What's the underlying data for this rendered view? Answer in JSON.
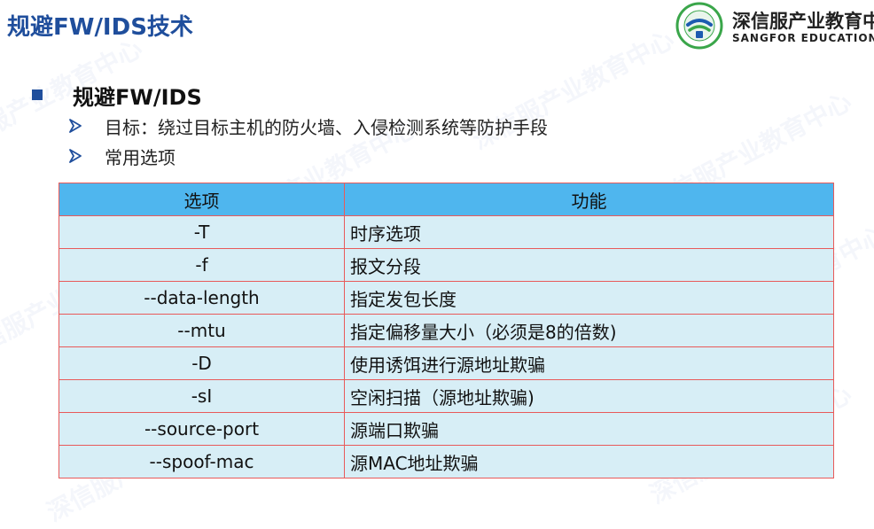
{
  "slide_title": "规避FW/IDS技术",
  "logo": {
    "cn_name": "深信服产业教育中",
    "en_name": "SANGFOR EDUCATION CEN",
    "colors": {
      "green": "#3aa64a",
      "blue": "#1c5bb0"
    }
  },
  "watermark": {
    "cn": "深信服产业教育中心",
    "en": "SANGFOR EDUCATION CENTER"
  },
  "section": {
    "heading": "规避FW/IDS",
    "bullets": [
      "目标：绕过目标主机的防火墙、入侵检测系统等防护手段",
      "常用选项"
    ]
  },
  "table": {
    "headers": [
      "选项",
      "功能"
    ],
    "rows": [
      {
        "option": "-T",
        "function": "时序选项"
      },
      {
        "option": "-f",
        "function": "报文分段"
      },
      {
        "option": "--data-length",
        "function": "指定发包长度"
      },
      {
        "option": "--mtu",
        "function": "指定偏移量大小（必须是8的倍数)"
      },
      {
        "option": "-D",
        "function": "使用诱饵进行源地址欺骗"
      },
      {
        "option": "-sI",
        "function": "空闲扫描（源地址欺骗)"
      },
      {
        "option": "--source-port",
        "function": "源端口欺骗"
      },
      {
        "option": "--spoof-mac",
        "function": "源MAC地址欺骗"
      }
    ],
    "colors": {
      "header_bg": "#4fb6ee",
      "row_bg": "#d7eef6",
      "border": "#e85a5a"
    }
  },
  "theme": {
    "title_color": "#1f4e9c",
    "bullet_color": "#1f4e9c"
  }
}
